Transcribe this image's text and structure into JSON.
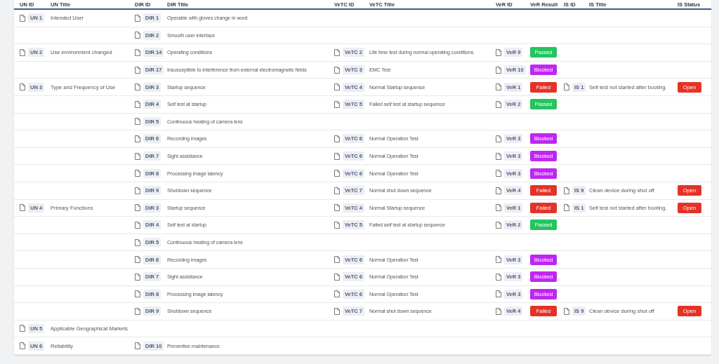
{
  "columns": [
    "UN ID",
    "UN Title",
    "DIR ID",
    "DIR Title",
    "VeTC ID",
    "VeTC Title",
    "VeR ID",
    "VeR Result",
    "IS ID",
    "IS Title",
    "IS Status"
  ],
  "rows": [
    {
      "un": {
        "id": "UN 1",
        "title": "Intended User"
      },
      "dir": {
        "id": "DIR 1",
        "title": "Operable with gloves change in word"
      }
    },
    {
      "dir": {
        "id": "DIR 2",
        "title": "Smooth user interface"
      }
    },
    {
      "un": {
        "id": "UN 2",
        "title": "Use environment changed"
      },
      "dir": {
        "id": "DIR 14",
        "title": "Operating conditions"
      },
      "vetc": {
        "id": "VeTC 2",
        "title": "Life time test during normal operating conditions."
      },
      "ver": {
        "id": "VeR 9",
        "result": "Passed",
        "color": "#22c55e"
      }
    },
    {
      "dir": {
        "id": "DIR 17",
        "title": "Insusceptible to interference from external electromagnetic fields"
      },
      "vetc": {
        "id": "VeTC 3",
        "title": "EMC Test"
      },
      "ver": {
        "id": "VeR 10",
        "result": "Blocked",
        "color": "#c026f3"
      }
    },
    {
      "un": {
        "id": "UN 3",
        "title": "Type and Frequency of Use"
      },
      "dir": {
        "id": "DIR 3",
        "title": "Startup sequence"
      },
      "vetc": {
        "id": "VeTC 4",
        "title": "Normal Startup sequence"
      },
      "ver": {
        "id": "VeR 1",
        "result": "Failed",
        "color": "#e53228"
      },
      "issue": {
        "id": "IS 1",
        "title": "Self test not started after booting.",
        "status": "Open",
        "color": "#e53228"
      }
    },
    {
      "dir": {
        "id": "DIR 4",
        "title": "Self test at startup"
      },
      "vetc": {
        "id": "VeTC 5",
        "title": "Failed self test at startup sequence"
      },
      "ver": {
        "id": "VeR 2",
        "result": "Passed",
        "color": "#22c55e"
      }
    },
    {
      "dir": {
        "id": "DIR 5",
        "title": "Continuous heating of camera lens"
      }
    },
    {
      "dir": {
        "id": "DIR 6",
        "title": "Recording images"
      },
      "vetc": {
        "id": "VeTC 6",
        "title": "Normal Operation Test"
      },
      "ver": {
        "id": "VeR 3",
        "result": "Blocked",
        "color": "#c026f3"
      }
    },
    {
      "dir": {
        "id": "DIR 7",
        "title": "Sight assistance"
      },
      "vetc": {
        "id": "VeTC 6",
        "title": "Normal Operation Test"
      },
      "ver": {
        "id": "VeR 3",
        "result": "Blocked",
        "color": "#c026f3"
      }
    },
    {
      "dir": {
        "id": "DIR 8",
        "title": "Processing image latency"
      },
      "vetc": {
        "id": "VeTC 6",
        "title": "Normal Operation Test"
      },
      "ver": {
        "id": "VeR 3",
        "result": "Blocked",
        "color": "#c026f3"
      }
    },
    {
      "dir": {
        "id": "DIR 9",
        "title": "Shutdown sequence"
      },
      "vetc": {
        "id": "VeTC 7",
        "title": "Normal shut down sequence"
      },
      "ver": {
        "id": "VeR 4",
        "result": "Failed",
        "color": "#e53228"
      },
      "issue": {
        "id": "IS 9",
        "title": "Clean device during shut off",
        "status": "Open",
        "color": "#e53228"
      }
    },
    {
      "un": {
        "id": "UN 4",
        "title": "Primary Functions"
      },
      "dir": {
        "id": "DIR 3",
        "title": "Startup sequence"
      },
      "vetc": {
        "id": "VeTC 4",
        "title": "Normal Startup sequence"
      },
      "ver": {
        "id": "VeR 1",
        "result": "Failed",
        "color": "#e53228"
      },
      "issue": {
        "id": "IS 1",
        "title": "Self test not started after booting.",
        "status": "Open",
        "color": "#e53228"
      }
    },
    {
      "dir": {
        "id": "DIR 4",
        "title": "Self test at startup"
      },
      "vetc": {
        "id": "VeTC 5",
        "title": "Failed self test at startup sequence"
      },
      "ver": {
        "id": "VeR 2",
        "result": "Passed",
        "color": "#22c55e"
      }
    },
    {
      "dir": {
        "id": "DIR 5",
        "title": "Continuous heating of camera lens"
      }
    },
    {
      "dir": {
        "id": "DIR 6",
        "title": "Recording images"
      },
      "vetc": {
        "id": "VeTC 6",
        "title": "Normal Operation Test"
      },
      "ver": {
        "id": "VeR 3",
        "result": "Blocked",
        "color": "#c026f3"
      }
    },
    {
      "dir": {
        "id": "DIR 7",
        "title": "Sight assistance"
      },
      "vetc": {
        "id": "VeTC 6",
        "title": "Normal Operation Test"
      },
      "ver": {
        "id": "VeR 3",
        "result": "Blocked",
        "color": "#c026f3"
      }
    },
    {
      "dir": {
        "id": "DIR 8",
        "title": "Processing image latency"
      },
      "vetc": {
        "id": "VeTC 6",
        "title": "Normal Operation Test"
      },
      "ver": {
        "id": "VeR 3",
        "result": "Blocked",
        "color": "#c026f3"
      }
    },
    {
      "dir": {
        "id": "DIR 9",
        "title": "Shutdown sequence"
      },
      "vetc": {
        "id": "VeTC 7",
        "title": "Normal shut down sequence"
      },
      "ver": {
        "id": "VeR 4",
        "result": "Failed",
        "color": "#e53228"
      },
      "issue": {
        "id": "IS 9",
        "title": "Clean device during shut off",
        "status": "Open",
        "color": "#e53228"
      }
    },
    {
      "un": {
        "id": "UN 5",
        "title": "Applicable Geographical Markets"
      }
    },
    {
      "un": {
        "id": "UN 6",
        "title": "Reliability"
      },
      "dir": {
        "id": "DIR 10",
        "title": "Preventive maintenance"
      }
    }
  ]
}
